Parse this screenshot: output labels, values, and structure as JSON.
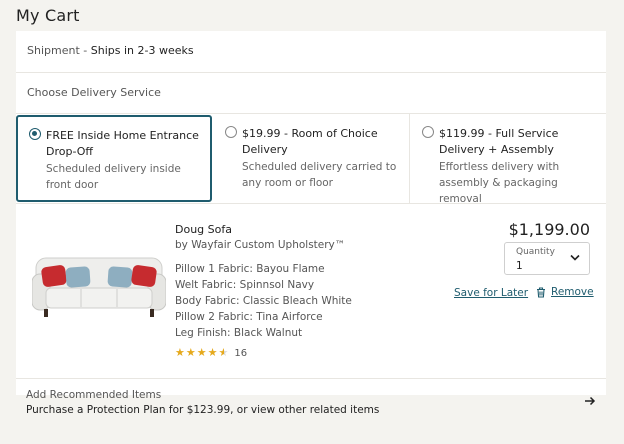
{
  "page": {
    "title": "My Cart"
  },
  "shipment": {
    "label": "Shipment - ",
    "value": "Ships in 2-3 weeks"
  },
  "delivery": {
    "heading": "Choose Delivery Service",
    "options": [
      {
        "title": "FREE Inside Home Entrance Drop-Off",
        "description": "Scheduled delivery inside front door",
        "selected": true
      },
      {
        "title": "$19.99 - Room of Choice Delivery",
        "description": "Scheduled delivery carried to any room or floor",
        "selected": false
      },
      {
        "title": "$119.99 - Full Service Delivery + Assembly",
        "description": "Effortless delivery with assembly & packaging removal",
        "selected": false
      }
    ]
  },
  "product": {
    "name": "Doug Sofa",
    "brand": "by Wayfair Custom Upholstery™",
    "attributes": [
      "Pillow 1 Fabric: Bayou Flame",
      "Welt Fabric: Spinnsol Navy",
      "Body Fabric: Classic Bleach White",
      "Pillow 2 Fabric: Tina Airforce",
      "Leg Finish: Black Walnut"
    ],
    "rating": 4.5,
    "review_count": "16",
    "price": "$1,199.00",
    "quantity": {
      "label": "Quantity",
      "value": "1"
    },
    "save_label": "Save for Later",
    "remove_label": "Remove"
  },
  "recommended": {
    "title": "Add Recommended Items",
    "subtitle": "Purchase a Protection Plan for $123.99, or view other related items"
  },
  "colors": {
    "accent": "#1f5c6e",
    "star": "#e5a91c",
    "pillow_red": "#c62b2f",
    "pillow_blue": "#8eaec0",
    "background": "#f4f3ef"
  }
}
